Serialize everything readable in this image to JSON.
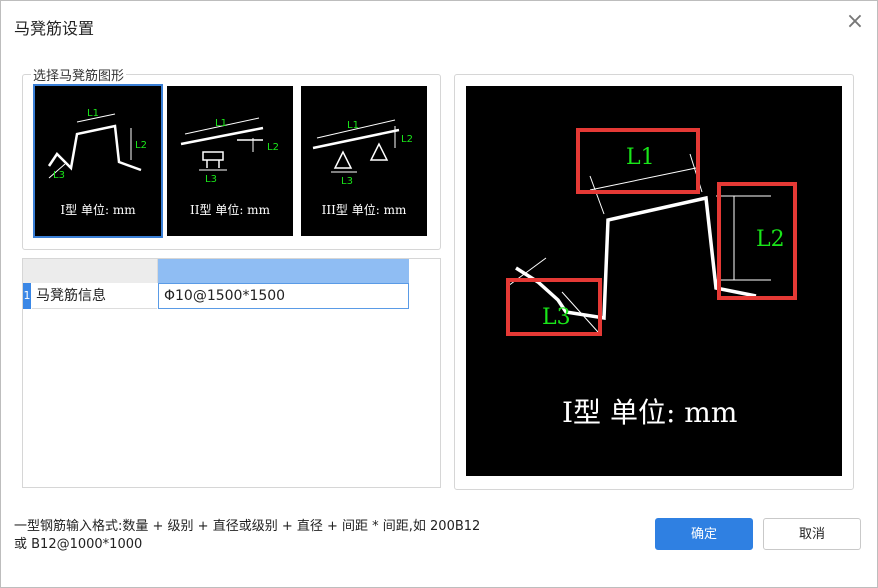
{
  "window": {
    "title": "马凳筋设置",
    "close_glyph": "×"
  },
  "shape_group": {
    "label": "选择马凳筋图形",
    "options": [
      {
        "caption": "I型 单位: mm",
        "selected": true,
        "labels": [
          "L1",
          "L2",
          "L3"
        ]
      },
      {
        "caption": "II型 单位: mm",
        "selected": false,
        "labels": [
          "L1",
          "L2",
          "L3"
        ]
      },
      {
        "caption": "III型 单位: mm",
        "selected": false,
        "labels": [
          "L1",
          "L2",
          "L3"
        ]
      }
    ]
  },
  "grid": {
    "row_number": "1",
    "name": "马凳筋信息",
    "value": "Φ10@1500*1500"
  },
  "preview": {
    "labels": {
      "l1": "L1",
      "l2": "L2",
      "l3": "L3"
    },
    "caption": "I型 单位: mm",
    "highlight_color": "#e53935",
    "label_color": "#19e619"
  },
  "hint": {
    "line1": "一型钢筋输入格式:数量 + 级别 + 直径或级别 + 直径 + 间距 * 间距,如 200B12",
    "line2": "或 B12@1000*1000"
  },
  "buttons": {
    "ok": "确定",
    "cancel": "取消"
  },
  "colors": {
    "accent": "#2f80e2",
    "selected_outline": "#3a7fd6"
  }
}
